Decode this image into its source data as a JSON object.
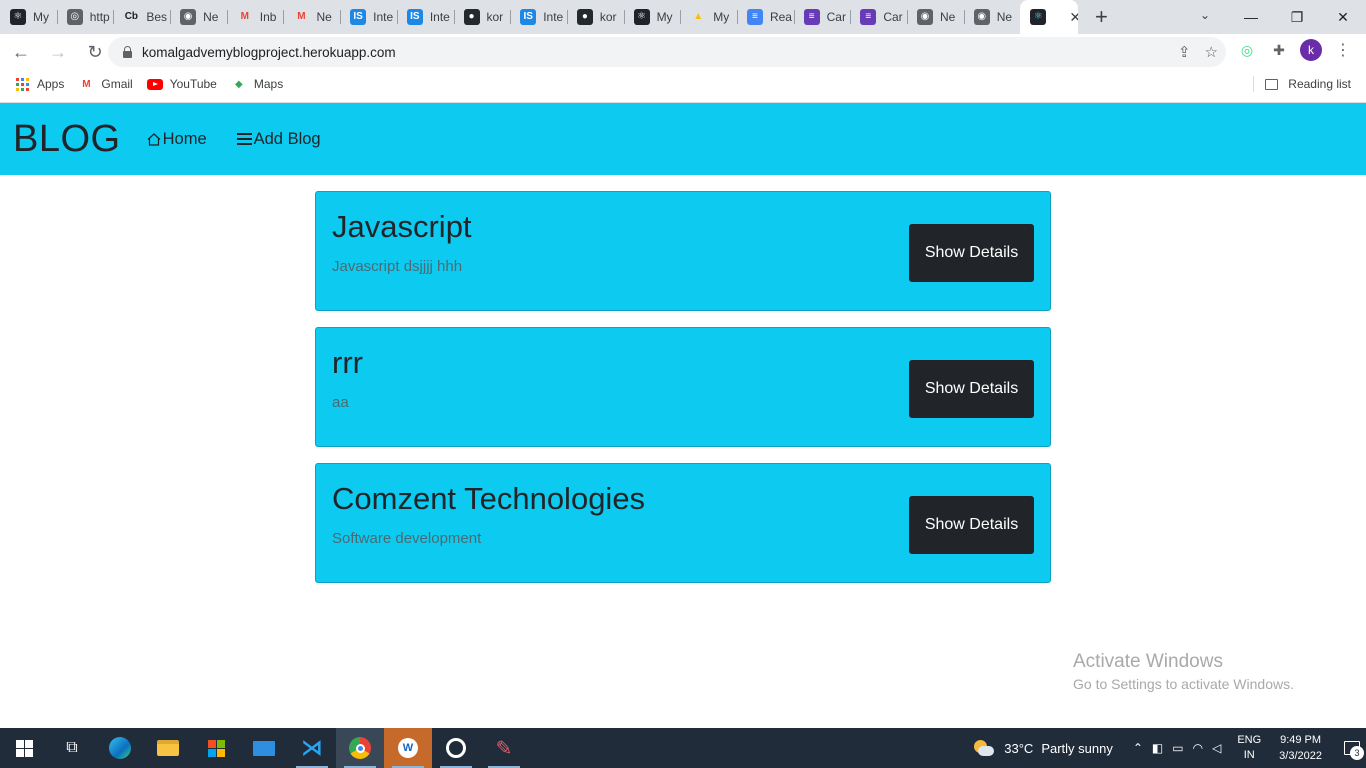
{
  "browser": {
    "tabs": [
      {
        "label": "My",
        "icon": "react-icon",
        "color": "#20232a",
        "glyph": "⚛"
      },
      {
        "label": "http",
        "icon": "globe-icon",
        "color": "#5f6368",
        "glyph": "◎"
      },
      {
        "label": "Bes",
        "icon": "cb-icon",
        "color": "#ffffff",
        "glyph": "Cb"
      },
      {
        "label": "Ne",
        "icon": "chrome-icon",
        "color": "#5f6368",
        "glyph": "◉"
      },
      {
        "label": "Inb",
        "icon": "gmail-icon",
        "color": "#ffffff",
        "glyph": "M"
      },
      {
        "label": "Ne",
        "icon": "gmail-icon",
        "color": "#ffffff",
        "glyph": "M"
      },
      {
        "label": "Inte",
        "icon": "is-icon",
        "color": "#1e88e5",
        "glyph": "IS"
      },
      {
        "label": "Inte",
        "icon": "is-icon",
        "color": "#1e88e5",
        "glyph": "IS"
      },
      {
        "label": "kor",
        "icon": "github-icon",
        "color": "#24292e",
        "glyph": "●"
      },
      {
        "label": "Inte",
        "icon": "is-icon",
        "color": "#1e88e5",
        "glyph": "IS"
      },
      {
        "label": "kor",
        "icon": "github-icon",
        "color": "#24292e",
        "glyph": "●"
      },
      {
        "label": "My",
        "icon": "react-icon",
        "color": "#20232a",
        "glyph": "⚛"
      },
      {
        "label": "My",
        "icon": "drive-icon",
        "color": "#ffffff",
        "glyph": "▲"
      },
      {
        "label": "Rea",
        "icon": "docs-icon",
        "color": "#4285f4",
        "glyph": "≡"
      },
      {
        "label": "Car",
        "icon": "forms-icon",
        "color": "#673ab7",
        "glyph": "≡"
      },
      {
        "label": "Car",
        "icon": "forms-icon",
        "color": "#673ab7",
        "glyph": "≡"
      },
      {
        "label": "Ne",
        "icon": "chrome-icon",
        "color": "#5f6368",
        "glyph": "◉"
      },
      {
        "label": "Ne",
        "icon": "chrome-icon",
        "color": "#5f6368",
        "glyph": "◉"
      }
    ],
    "active_tab": {
      "label": "",
      "icon": "react-icon",
      "glyph": "⚛",
      "close": "✕"
    },
    "new_tab": "+",
    "address": "komalgadvemyblogproject.herokuapp.com",
    "profile_letter": "k",
    "bookmarks": [
      {
        "label": "Apps",
        "icon": "apps-grid-icon"
      },
      {
        "label": "Gmail",
        "icon": "gmail-icon"
      },
      {
        "label": "YouTube",
        "icon": "youtube-icon"
      },
      {
        "label": "Maps",
        "icon": "maps-icon"
      }
    ],
    "reading_list": "Reading list"
  },
  "navbar": {
    "brand": "BLOG",
    "links": [
      {
        "label": "Home",
        "icon": "house-icon"
      },
      {
        "label": "Add Blog",
        "icon": "menu-icon"
      }
    ],
    "color": "#0dcaf0"
  },
  "blogs": [
    {
      "title": "Javascript",
      "description": "Javascript dsjjjj hhh",
      "button": "Show Details"
    },
    {
      "title": "rrr",
      "description": "aa",
      "button": "Show Details"
    },
    {
      "title": "Comzent Technologies",
      "description": "Software development",
      "button": "Show Details"
    }
  ],
  "watermark": {
    "title": "Activate Windows",
    "subtitle": "Go to Settings to activate Windows."
  },
  "taskbar": {
    "weather_temp": "33°C",
    "weather_text": "Partly sunny",
    "lang_line1": "ENG",
    "lang_line2": "IN",
    "time": "9:49 PM",
    "date": "3/3/2022",
    "notifications": "3"
  }
}
